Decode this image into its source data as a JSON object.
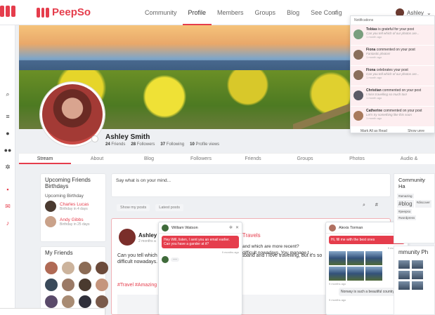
{
  "brand": {
    "name": "PeepSo",
    "color": "#e53d4c"
  },
  "nav": {
    "items": [
      "Community",
      "Profile",
      "Members",
      "Groups",
      "Blog",
      "See Config"
    ],
    "active": "Profile",
    "user_name": "Ashley"
  },
  "profile": {
    "name": "Ashley Smith",
    "stats": [
      {
        "count": "24",
        "label": "Friends"
      },
      {
        "count": "28",
        "label": "Followers"
      },
      {
        "count": "37",
        "label": "Following"
      },
      {
        "count": "10",
        "label": "Profile views"
      }
    ]
  },
  "tabs": [
    "Stream",
    "About",
    "Blog",
    "Followers",
    "Friends",
    "Groups",
    "Photos",
    "Audio &"
  ],
  "left_sidebar": {
    "birthdays_title": "Upcoming Friends Birthdays",
    "birthdays_sub": "Upcoming Birthday",
    "birthdays": [
      {
        "name": "Charles Lucas",
        "when": "Birthday in 4 days"
      },
      {
        "name": "Andy Gibbs",
        "when": "Birthday in 25 days"
      }
    ],
    "friends_title": "My Friends"
  },
  "composer": {
    "placeholder": "Say what is on your mind..."
  },
  "filters": {
    "show": "Show my posts",
    "latest": "Latest posts"
  },
  "post": {
    "author": "Ashley S",
    "time": "2 months a",
    "text": "Can you tell which of our photos are the most recent? Husband and I love travelling, but it's so difficult nowadays. Be safe everyone, we miss travelling!",
    "text_right_1": "and which are more recent?",
    "text_right_2": "difficult nowadays. You manage t",
    "title_fragment": "r Travels",
    "hashtags": "#Travel #Amazing"
  },
  "chat1": {
    "name": "William Watson",
    "message": "Hey Will, listen, I sent you an email earlier. Can you have a gander at it?",
    "time": "9 months ago"
  },
  "chat2": {
    "name": "Alexis Torman",
    "msg1": "Hi, fill me with the best ones",
    "time1": "9 months ago",
    "time2": "9 months ago",
    "msg2": "Norway is such a beautiful country",
    "time3": "9 months ago"
  },
  "notifications": {
    "header": "Notifications",
    "items": [
      {
        "actor": "Tobias",
        "action": "is grateful for your post",
        "sub": "Can you tell which of our photos are...",
        "time": "1 month ago",
        "color": "#7a9e7e"
      },
      {
        "actor": "Fiona",
        "action": "commented on your post",
        "sub": "Fantastic photos!",
        "time": "1 month ago",
        "color": "#8a6f5c"
      },
      {
        "actor": "Fiona",
        "action": "celebrates your post",
        "sub": "Can you tell which of our photos are...",
        "time": "1 month ago",
        "color": "#8a6f5c"
      },
      {
        "actor": "Christian",
        "action": "commented on your post",
        "sub": "I miss travelling so much too!",
        "time": "1 month ago",
        "color": "#5b5b66"
      },
      {
        "actor": "Catherine",
        "action": "commented on your post",
        "sub": "Let's try something like this soon",
        "time": "1 month ago",
        "color": "#a87a5c"
      }
    ],
    "mark_all": "Mark All as Read",
    "show_unread": "Show unre"
  },
  "hashtags": {
    "title": "Community Ha",
    "tags": [
      "#amazing",
      "#blog",
      "#discover",
      "#peepso",
      "#wordpress"
    ]
  },
  "photos_widget": {
    "title": "mmunity Ph"
  }
}
